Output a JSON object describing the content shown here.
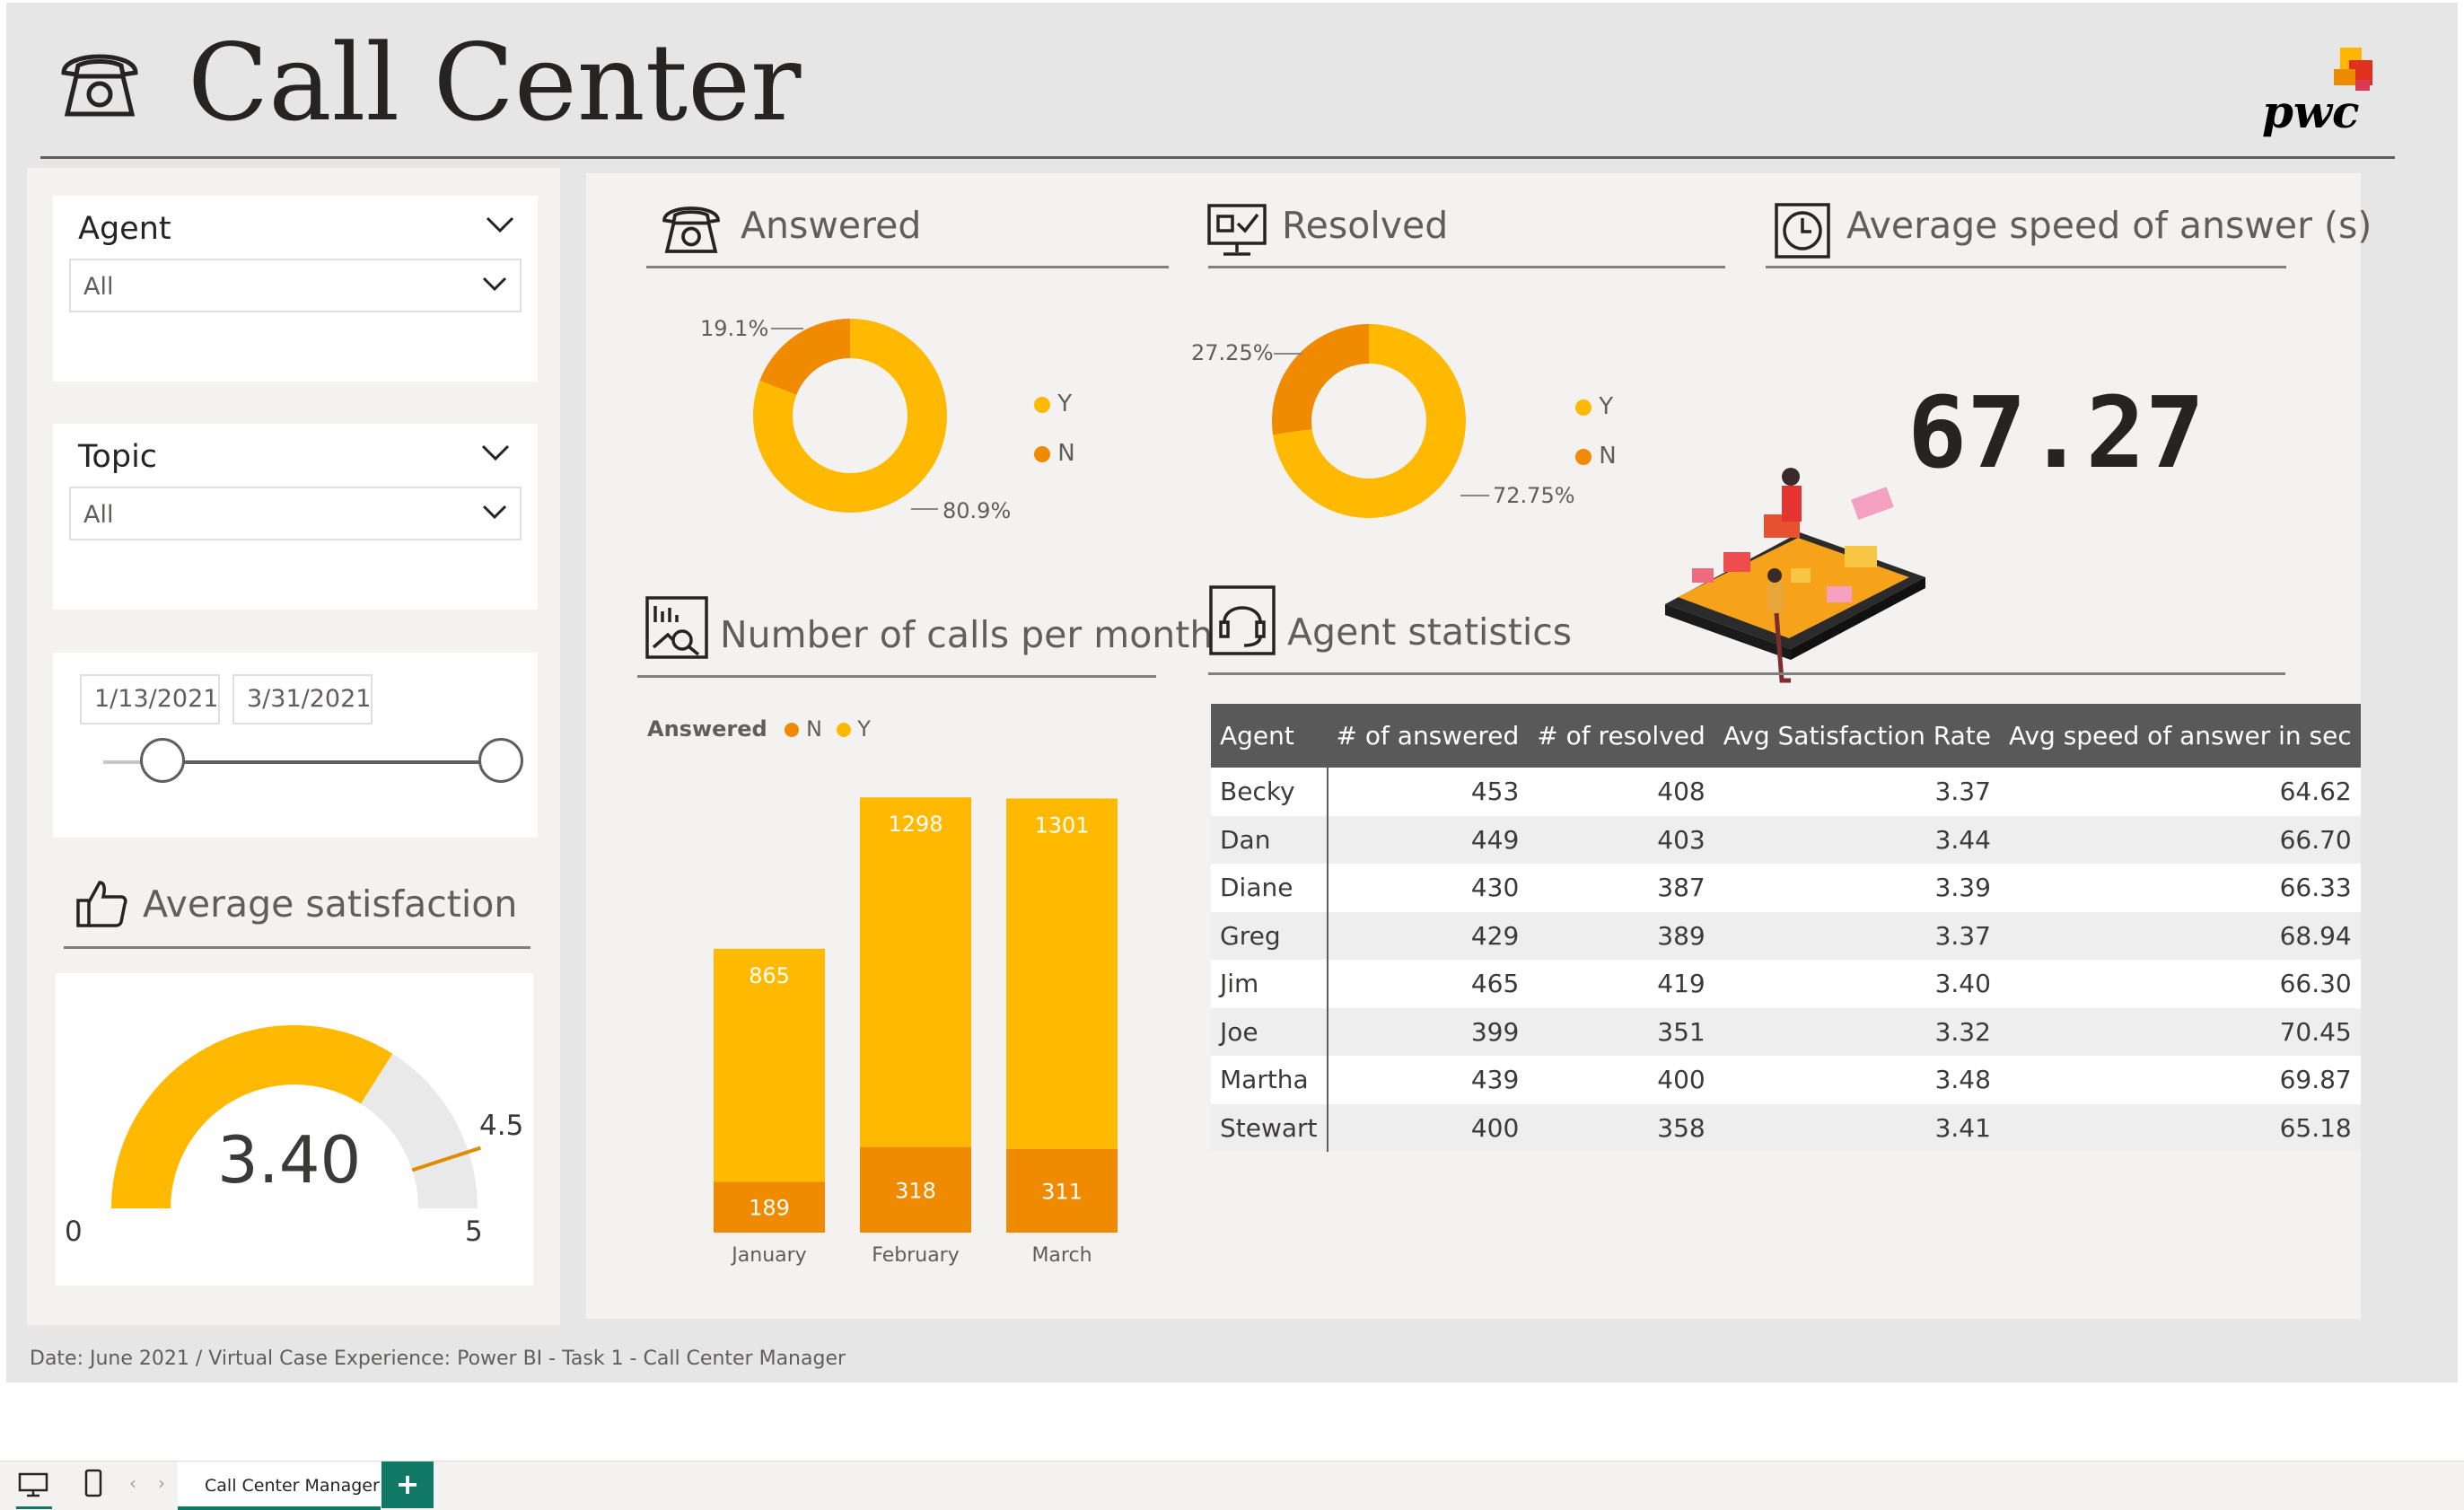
{
  "header": {
    "title": "Call Center",
    "logo_text": "pwc"
  },
  "filters": {
    "agent": {
      "label": "Agent",
      "selected": "All"
    },
    "topic": {
      "label": "Topic",
      "selected": "All"
    },
    "date": {
      "start": "1/13/2021",
      "end": "3/31/2021"
    }
  },
  "satisfaction": {
    "title": "Average satisfaction",
    "value": "3.40",
    "min": "0",
    "max": "5",
    "target": "4.5",
    "value_num": 3.4,
    "min_num": 0,
    "max_num": 5,
    "target_num": 4.5
  },
  "answered": {
    "title": "Answered",
    "slices": [
      {
        "label": "Y",
        "pct": "80.9%",
        "value": 80.9,
        "color": "#ffb900"
      },
      {
        "label": "N",
        "pct": "19.1%",
        "value": 19.1,
        "color": "#f08a00"
      }
    ]
  },
  "resolved": {
    "title": "Resolved",
    "slices": [
      {
        "label": "Y",
        "pct": "72.75%",
        "value": 72.75,
        "color": "#ffb900"
      },
      {
        "label": "N",
        "pct": "27.25%",
        "value": 27.25,
        "color": "#f08a00"
      }
    ]
  },
  "speed": {
    "title": "Average speed of answer (s)",
    "value": "67.27"
  },
  "calls_chart": {
    "title": "Number of calls per month",
    "legend_title": "Answered",
    "legend": [
      {
        "label": "N",
        "color": "#f08a00"
      },
      {
        "label": "Y",
        "color": "#ffb900"
      }
    ]
  },
  "chart_data": {
    "type": "bar",
    "stacked": true,
    "categories": [
      "January",
      "February",
      "March"
    ],
    "series": [
      {
        "name": "N",
        "values": [
          189,
          318,
          311
        ],
        "color": "#f08a00"
      },
      {
        "name": "Y",
        "values": [
          865,
          1298,
          1301
        ],
        "color": "#ffb900"
      }
    ],
    "title": "Number of calls per month",
    "legend_title": "Answered",
    "legend_position": "top-left",
    "ylim": [
      0,
      1700
    ],
    "grid": false
  },
  "agent_stats": {
    "title": "Agent statistics",
    "columns": [
      "Agent",
      "# of answered",
      "# of resolved",
      "Avg Satisfaction Rate",
      "Avg speed of answer in sec"
    ],
    "rows": [
      [
        "Becky",
        "453",
        "408",
        "3.37",
        "64.62"
      ],
      [
        "Dan",
        "449",
        "403",
        "3.44",
        "66.70"
      ],
      [
        "Diane",
        "430",
        "387",
        "3.39",
        "66.33"
      ],
      [
        "Greg",
        "429",
        "389",
        "3.37",
        "68.94"
      ],
      [
        "Jim",
        "465",
        "419",
        "3.40",
        "66.30"
      ],
      [
        "Joe",
        "399",
        "351",
        "3.32",
        "70.45"
      ],
      [
        "Martha",
        "439",
        "400",
        "3.48",
        "69.87"
      ],
      [
        "Stewart",
        "400",
        "358",
        "3.41",
        "65.18"
      ]
    ]
  },
  "footer": {
    "note": "Date: June 2021 / Virtual Case Experience: Power BI - Task 1 - Call Center Manager"
  },
  "tabs": {
    "page_tab": "Call Center Manager",
    "add_label": "+"
  },
  "icons": {
    "phone": "phone-icon",
    "monitor-check": "monitor-check-icon",
    "clock": "clock-icon",
    "chart-report": "chart-report-icon",
    "headset": "headset-icon",
    "thumbs-up": "thumbs-up-icon",
    "chevron": "chevron-down-icon",
    "desktop": "desktop-icon",
    "mobile": "mobile-icon"
  },
  "colors": {
    "accent": "#ffb900",
    "accent_dark": "#f08a00",
    "table_header": "#595959",
    "tab_green": "#117865"
  }
}
